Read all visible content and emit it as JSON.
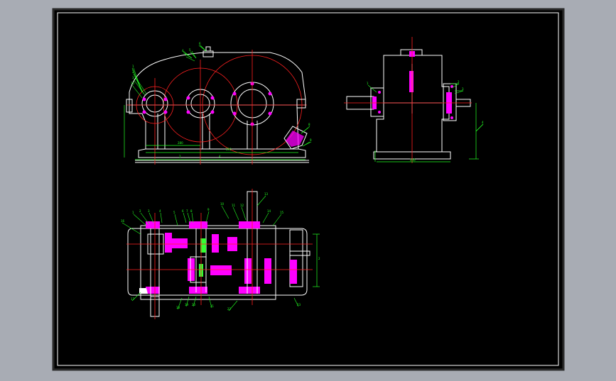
{
  "app": {
    "background": "#a8acb4",
    "sheet_fill": "#000000",
    "sheet_border": "#ffffff"
  },
  "colors": {
    "outline": "#ffffff",
    "centerline": "#ff2020",
    "dimension": "#22ff22",
    "section": "#ff00ff",
    "leader": "#ffff00"
  },
  "views": {
    "front": {
      "dims": [
        "280",
        "590",
        "2",
        "4"
      ]
    },
    "side": {
      "dims": [
        "240"
      ]
    },
    "top": {
      "dims": [
        "2"
      ]
    }
  },
  "balloons": {
    "front": [
      "1",
      "2",
      "3",
      "4",
      "5",
      "6",
      "7",
      "8",
      "9",
      "10"
    ],
    "side": [
      "1",
      "2",
      "3",
      "4"
    ],
    "top": [
      "1",
      "2",
      "3",
      "4",
      "5",
      "6",
      "7",
      "8",
      "9",
      "10",
      "11",
      "12",
      "13",
      "14",
      "15",
      "16",
      "17",
      "18",
      "19",
      "20",
      "21",
      "22",
      "23"
    ]
  }
}
